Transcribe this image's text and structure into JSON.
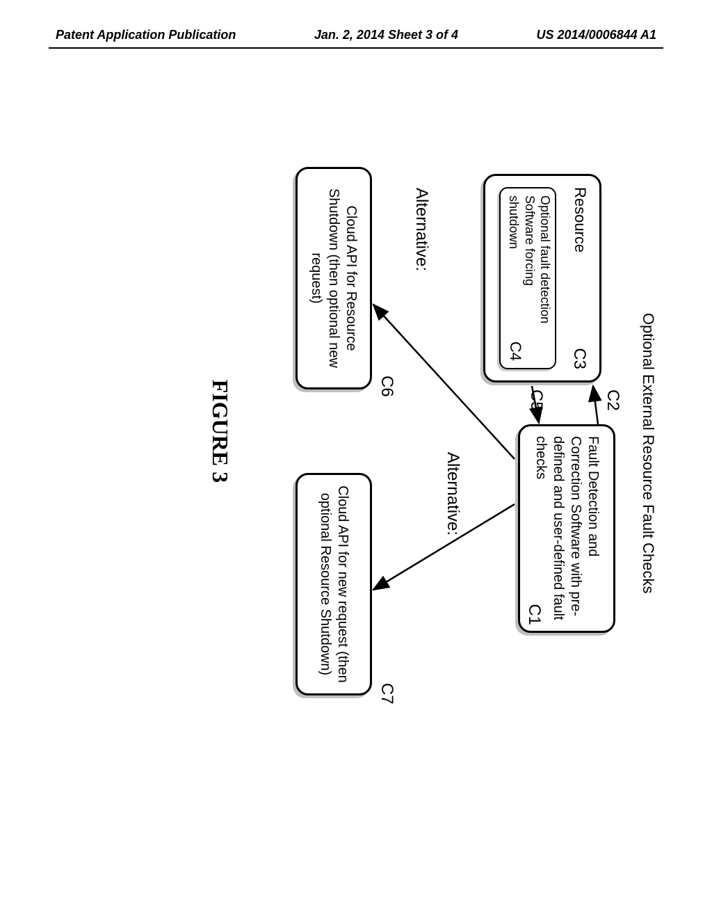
{
  "header": {
    "left": "Patent Application Publication",
    "center": "Jan. 2, 2014  Sheet 3 of 4",
    "right": "US 2014/0006844 A1"
  },
  "diagram": {
    "title": "Optional External Resource Fault Checks",
    "c1_text": "Fault Detection and Correction Software with pre-defined and user-defined fault checks",
    "c1_label": "C1",
    "c2_label": "C2",
    "c3_title": "Resource",
    "c3_label": "C3",
    "c4_text": "Optional fault detection Software forcing shutdown",
    "c4_label": "C4",
    "c5_label": "C5",
    "c6_text": "Cloud API for Resource Shutdown (then optional new request)",
    "c6_label": "C6",
    "c7_text": "Cloud API for new request (then optional Resource Shutdown)",
    "c7_label": "C7",
    "alt_label_1": "Alternative:",
    "alt_label_2": "Alternative:"
  },
  "figure_label": "FIGURE 3"
}
